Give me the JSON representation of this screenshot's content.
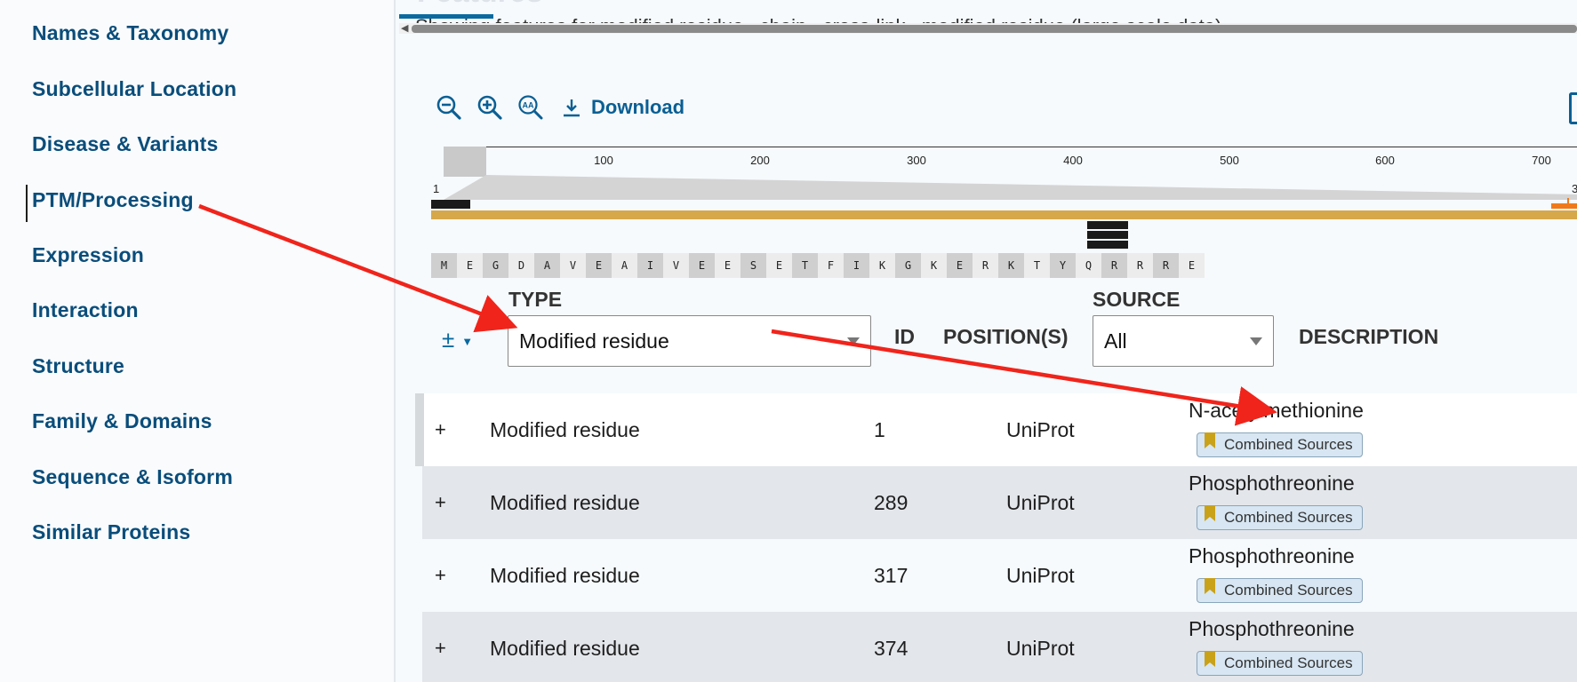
{
  "sidebar": {
    "items": [
      {
        "label": "Names & Taxonomy"
      },
      {
        "label": "Subcellular Location"
      },
      {
        "label": "Disease & Variants"
      },
      {
        "label": "PTM/Processing"
      },
      {
        "label": "Expression"
      },
      {
        "label": "Interaction"
      },
      {
        "label": "Structure"
      },
      {
        "label": "Family & Domains"
      },
      {
        "label": "Sequence & Isoform"
      },
      {
        "label": "Similar Proteins"
      }
    ],
    "active": "PTM/Processing"
  },
  "main": {
    "section_title": "Features",
    "showing_text": "Showing features for modified residue , chain , cross-link , modified residue (large scale data) .",
    "toolbar": {
      "zoom_out_icon": "zoom-out-icon",
      "zoom_in_icon": "zoom-in-icon",
      "zoom_text_icon": "zoom-text-icon",
      "download_label": "Download"
    },
    "viewer": {
      "ruler_ticks": [
        "100",
        "200",
        "300",
        "400",
        "500",
        "600",
        "700"
      ],
      "start_pos": "1",
      "end_pos": "3",
      "sequence": [
        "M",
        "E",
        "G",
        "D",
        "A",
        "V",
        "E",
        "A",
        "I",
        "V",
        "E",
        "E",
        "S",
        "E",
        "T",
        "F",
        "I",
        "K",
        "G",
        "K",
        "E",
        "R",
        "K",
        "T",
        "Y",
        "Q",
        "R",
        "R",
        "R",
        "E"
      ]
    },
    "table": {
      "add_col_label": "±",
      "headers": {
        "type": "TYPE",
        "id": "ID",
        "positions": "POSITION(S)",
        "source": "SOURCE",
        "description": "DESCRIPTION"
      },
      "type_filter": "Modified residue",
      "source_filter": "All",
      "rows": [
        {
          "expand": "+",
          "type": "Modified residue",
          "position": "1",
          "source": "UniProt",
          "description": "N-acetylmethionine",
          "evidence": "Combined Sources"
        },
        {
          "expand": "+",
          "type": "Modified residue",
          "position": "289",
          "source": "UniProt",
          "description": "Phosphothreonine",
          "evidence": "Combined Sources"
        },
        {
          "expand": "+",
          "type": "Modified residue",
          "position": "317",
          "source": "UniProt",
          "description": "Phosphothreonine",
          "evidence": "Combined Sources"
        },
        {
          "expand": "+",
          "type": "Modified residue",
          "position": "374",
          "source": "UniProt",
          "description": "Phosphothreonine",
          "evidence": "Combined Sources"
        }
      ]
    }
  },
  "colors": {
    "link": "#0a4d7a",
    "accent": "#0a6aa0",
    "chain": "#d6a84a",
    "annotation_arrow": "#f0241b",
    "badge_bg": "#d7e6f2",
    "bookmark": "#c9a21a"
  }
}
